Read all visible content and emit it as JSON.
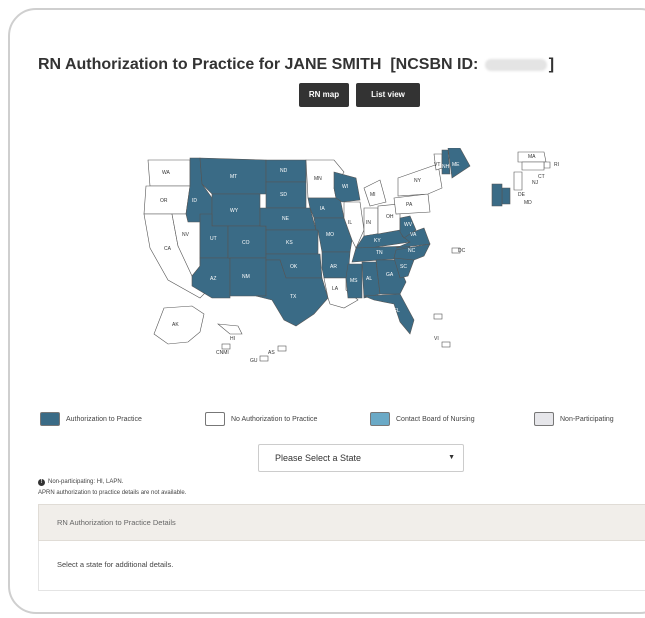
{
  "header": {
    "title_prefix": "RN Authorization to Practice for ",
    "name": "JANE SMITH",
    "id_label": "[NCSBN ID:",
    "id_close": "]"
  },
  "view_toggle": {
    "map_label": "RN map",
    "list_label": "List view"
  },
  "colors": {
    "authorized": "#3a6b86",
    "not_authorized": "#ffffff",
    "contact_board": "#6aa9c6",
    "non_participating": "#e6e6ea"
  },
  "map": {
    "states_authorized": [
      "MT",
      "ND",
      "ID",
      "WY",
      "SD",
      "NE",
      "IA",
      "WI",
      "UT",
      "CO",
      "AZ",
      "NM",
      "KS",
      "MO",
      "OK",
      "AR",
      "TX",
      "MS",
      "AL",
      "TN",
      "KY",
      "WV",
      "VA",
      "NC",
      "SC",
      "GA",
      "FL",
      "ME",
      "NH",
      "DE",
      "MD"
    ],
    "states_not_authorized": [
      "WA",
      "OR",
      "CA",
      "NV",
      "MN",
      "MI",
      "IL",
      "IN",
      "OH",
      "PA",
      "NY",
      "VT",
      "MA",
      "CT",
      "RI",
      "NJ",
      "LA",
      "AK",
      "HI"
    ],
    "labels": {
      "WA": "WA",
      "OR": "OR",
      "CA": "CA",
      "NV": "NV",
      "ID": "ID",
      "MT": "MT",
      "WY": "WY",
      "UT": "UT",
      "AZ": "AZ",
      "CO": "CO",
      "NM": "NM",
      "ND": "ND",
      "SD": "SD",
      "NE": "NE",
      "KS": "KS",
      "OK": "OK",
      "TX": "TX",
      "MN": "MN",
      "IA": "IA",
      "MO": "MO",
      "AR": "AR",
      "LA": "LA",
      "WI": "WI",
      "IL": "IL",
      "MS": "MS",
      "MI": "MI",
      "IN": "IN",
      "KY": "KY",
      "TN": "TN",
      "AL": "AL",
      "OH": "OH",
      "GA": "GA",
      "FL": "FL",
      "SC": "SC",
      "NC": "NC",
      "VA": "VA",
      "WV": "WV",
      "PA": "PA",
      "NY": "NY",
      "ME": "ME",
      "NH": "NH",
      "VT": "VT",
      "AK": "AK",
      "HI": "HI",
      "DC": "DC",
      "VI": "VI",
      "GU": "GU",
      "AS": "AS",
      "CNMI": "CNMI",
      "NJ": "NJ",
      "DE": "DE",
      "MD": "MD",
      "RI": "RI",
      "CT": "CT",
      "MA": "MA"
    }
  },
  "legend": [
    {
      "label": "Authorization to Practice",
      "color": "#3a6b86"
    },
    {
      "label": "No Authorization to Practice",
      "color": "#ffffff"
    },
    {
      "label": "Contact Board of Nursing",
      "color": "#6aa9c6"
    },
    {
      "label": "Non-Participating",
      "color": "#e6e6ea"
    }
  ],
  "state_select": {
    "selected": "Please Select a State"
  },
  "notes": {
    "non_participating": "Non-participating: HI, LAPN.",
    "aprn": "APRN authorization to practice details are not available."
  },
  "details": {
    "heading": "RN Authorization to Practice Details",
    "message": "Select a state for additional details."
  }
}
